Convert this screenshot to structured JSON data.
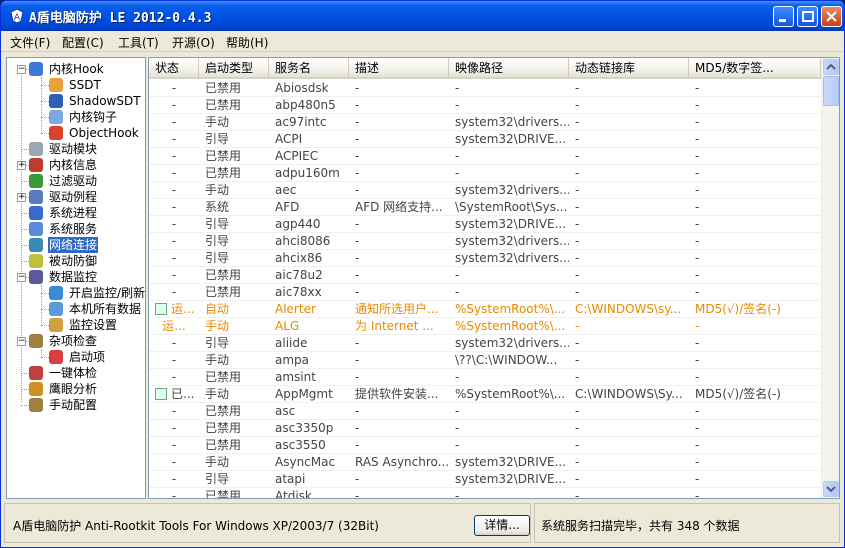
{
  "window": {
    "title": "A盾电脑防护 LE 2012-0.4.3"
  },
  "menu": [
    "文件(F)",
    "配置(C)",
    "工具(T)",
    "开源(O)",
    "帮助(H)"
  ],
  "tree": [
    {
      "label": "内核Hook",
      "icon": "kernel-hook-icon",
      "level": 0,
      "expander": "minus"
    },
    {
      "label": "SSDT",
      "icon": "ssdt-icon",
      "level": 1
    },
    {
      "label": "ShadowSDT",
      "icon": "shadowsdt-icon",
      "level": 1
    },
    {
      "label": "内核钩子",
      "icon": "kernel-hook-sub-icon",
      "level": 1
    },
    {
      "label": "ObjectHook",
      "icon": "object-hook-icon",
      "level": 1
    },
    {
      "label": "驱动模块",
      "icon": "driver-module-icon",
      "level": 0
    },
    {
      "label": "内核信息",
      "icon": "kernel-info-icon",
      "level": 0,
      "expander": "plus"
    },
    {
      "label": "过滤驱动",
      "icon": "filter-driver-icon",
      "level": 0
    },
    {
      "label": "驱动例程",
      "icon": "driver-routine-icon",
      "level": 0,
      "expander": "plus"
    },
    {
      "label": "系统进程",
      "icon": "system-process-icon",
      "level": 0
    },
    {
      "label": "系统服务",
      "icon": "system-service-icon",
      "level": 0
    },
    {
      "label": "网络连接",
      "icon": "network-icon",
      "level": 0,
      "selected": true
    },
    {
      "label": "被动防御",
      "icon": "passive-defense-icon",
      "level": 0
    },
    {
      "label": "数据监控",
      "icon": "data-monitor-icon",
      "level": 0,
      "expander": "minus"
    },
    {
      "label": "开启监控/刷新",
      "icon": "monitor-refresh-icon",
      "level": 1
    },
    {
      "label": "本机所有数据",
      "icon": "local-data-icon",
      "level": 1
    },
    {
      "label": "监控设置",
      "icon": "monitor-settings-icon",
      "level": 1
    },
    {
      "label": "杂项检查",
      "icon": "misc-check-icon",
      "level": 0,
      "expander": "minus"
    },
    {
      "label": "启动项",
      "icon": "startup-icon",
      "level": 1
    },
    {
      "label": "一键体检",
      "icon": "one-click-check-icon",
      "level": 0
    },
    {
      "label": "鹰眼分析",
      "icon": "eagle-eye-icon",
      "level": 0
    },
    {
      "label": "手动配置",
      "icon": "manual-config-icon",
      "level": 0
    }
  ],
  "table": {
    "columns": [
      "状态",
      "启动类型",
      "服务名",
      "描述",
      "映像路径",
      "动态链接库",
      "MD5/数字签..."
    ],
    "rows": [
      [
        "-",
        "已禁用",
        "Abiosdsk",
        "-",
        "-",
        "-",
        "-"
      ],
      [
        "-",
        "已禁用",
        "abp480n5",
        "-",
        "-",
        "-",
        "-"
      ],
      [
        "-",
        "手动",
        "ac97intc",
        "-",
        "system32\\drivers...",
        "-",
        "-"
      ],
      [
        "-",
        "引导",
        "ACPI",
        "-",
        "system32\\DRIVE...",
        "-",
        "-"
      ],
      [
        "-",
        "已禁用",
        "ACPIEC",
        "-",
        "-",
        "-",
        "-"
      ],
      [
        "-",
        "已禁用",
        "adpu160m",
        "-",
        "-",
        "-",
        "-"
      ],
      [
        "-",
        "手动",
        "aec",
        "-",
        "system32\\drivers...",
        "-",
        "-"
      ],
      [
        "-",
        "系统",
        "AFD",
        "AFD 网络支持...",
        "\\SystemRoot\\Sys...",
        "-",
        "-"
      ],
      [
        "-",
        "引导",
        "agp440",
        "-",
        "system32\\DRIVE...",
        "-",
        "-"
      ],
      [
        "-",
        "引导",
        "ahci8086",
        "-",
        "system32\\drivers...",
        "-",
        "-"
      ],
      [
        "-",
        "引导",
        "ahcix86",
        "-",
        "system32\\drivers...",
        "-",
        "-"
      ],
      [
        "-",
        "已禁用",
        "aic78u2",
        "-",
        "-",
        "-",
        "-"
      ],
      [
        "-",
        "已禁用",
        "aic78xx",
        "-",
        "-",
        "-",
        "-"
      ],
      [
        "运...",
        "自动",
        "Alerter",
        "通知所选用户...",
        "%SystemRoot%\\...",
        "C:\\WINDOWS\\sy...",
        "MD5(√)/签名(-)"
      ],
      [
        "运...",
        "手动",
        "ALG",
        "为 Internet ...",
        "%SystemRoot%\\...",
        "-",
        "-"
      ],
      [
        "-",
        "引导",
        "aliide",
        "-",
        "system32\\drivers...",
        "-",
        "-"
      ],
      [
        "-",
        "手动",
        "ampa",
        "-",
        "\\??\\C:\\WINDOW...",
        "-",
        "-"
      ],
      [
        "-",
        "已禁用",
        "amsint",
        "-",
        "-",
        "-",
        "-"
      ],
      [
        "已...",
        "手动",
        "AppMgmt",
        "提供软件安装...",
        "%SystemRoot%\\...",
        "C:\\WINDOWS\\Sy...",
        "MD5(√)/签名(-)"
      ],
      [
        "-",
        "已禁用",
        "asc",
        "-",
        "-",
        "-",
        "-"
      ],
      [
        "-",
        "已禁用",
        "asc3350p",
        "-",
        "-",
        "-",
        "-"
      ],
      [
        "-",
        "已禁用",
        "asc3550",
        "-",
        "-",
        "-",
        "-"
      ],
      [
        "-",
        "手动",
        "AsyncMac",
        "RAS Asynchro...",
        "system32\\DRIVE...",
        "-",
        "-"
      ],
      [
        "-",
        "引导",
        "atapi",
        "-",
        "system32\\DRIVE...",
        "-",
        "-"
      ],
      [
        "-",
        "已禁用",
        "Atdisk",
        "-",
        "-",
        "-",
        "-"
      ]
    ],
    "highlighted_rows": [
      13,
      14
    ],
    "icon_rows": [
      13,
      18
    ]
  },
  "status": {
    "left_text": "A盾电脑防护 Anti-Rootkit Tools For Windows XP/2003/7 (32Bit)",
    "detail_button": "详情...",
    "right_text": "系统服务扫描完毕，共有 348 个数据"
  },
  "colors": {
    "titlebar": "#0054e3",
    "highlight_text": "#e88a00",
    "selection": "#316ac5"
  }
}
